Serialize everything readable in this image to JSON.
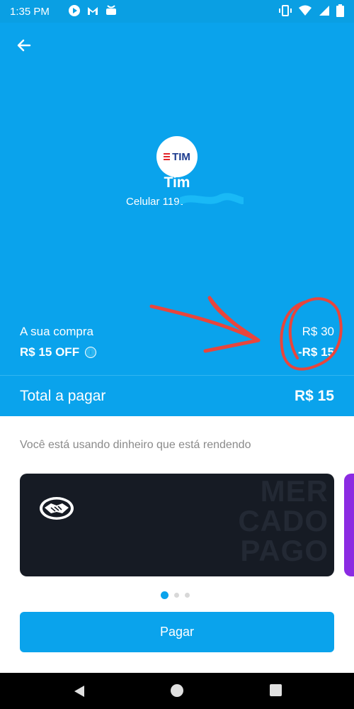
{
  "status_bar": {
    "time": "1:35 PM",
    "left_icons": [
      "play-icon",
      "mail-icon",
      "app-icon"
    ],
    "right_icons": [
      "vibrate-icon",
      "wifi-icon",
      "signal-icon",
      "battery-icon"
    ]
  },
  "header": {
    "back_icon": "arrow-left-icon",
    "operator_logo_text": "TIM",
    "operator_name": "Tim",
    "phone_label": "Celular 1195"
  },
  "purchase": {
    "label": "A sua compra",
    "value": "R$ 30",
    "discount_label": "R$ 15 OFF",
    "discount_value": "-R$ 15"
  },
  "total": {
    "label": "Total a pagar",
    "value": "R$ 15"
  },
  "payment": {
    "info_text": "Você está usando dinheiro que está rendendo",
    "card_watermark": [
      "MER",
      "CADO",
      "PAGO"
    ],
    "pagination_count": 3,
    "pagination_active": 1,
    "pay_button_label": "Pagar"
  },
  "colors": {
    "primary": "#0aa3ec",
    "card": "#161b24",
    "next_card": "#8b2be2",
    "annotation": "#e8453c"
  }
}
